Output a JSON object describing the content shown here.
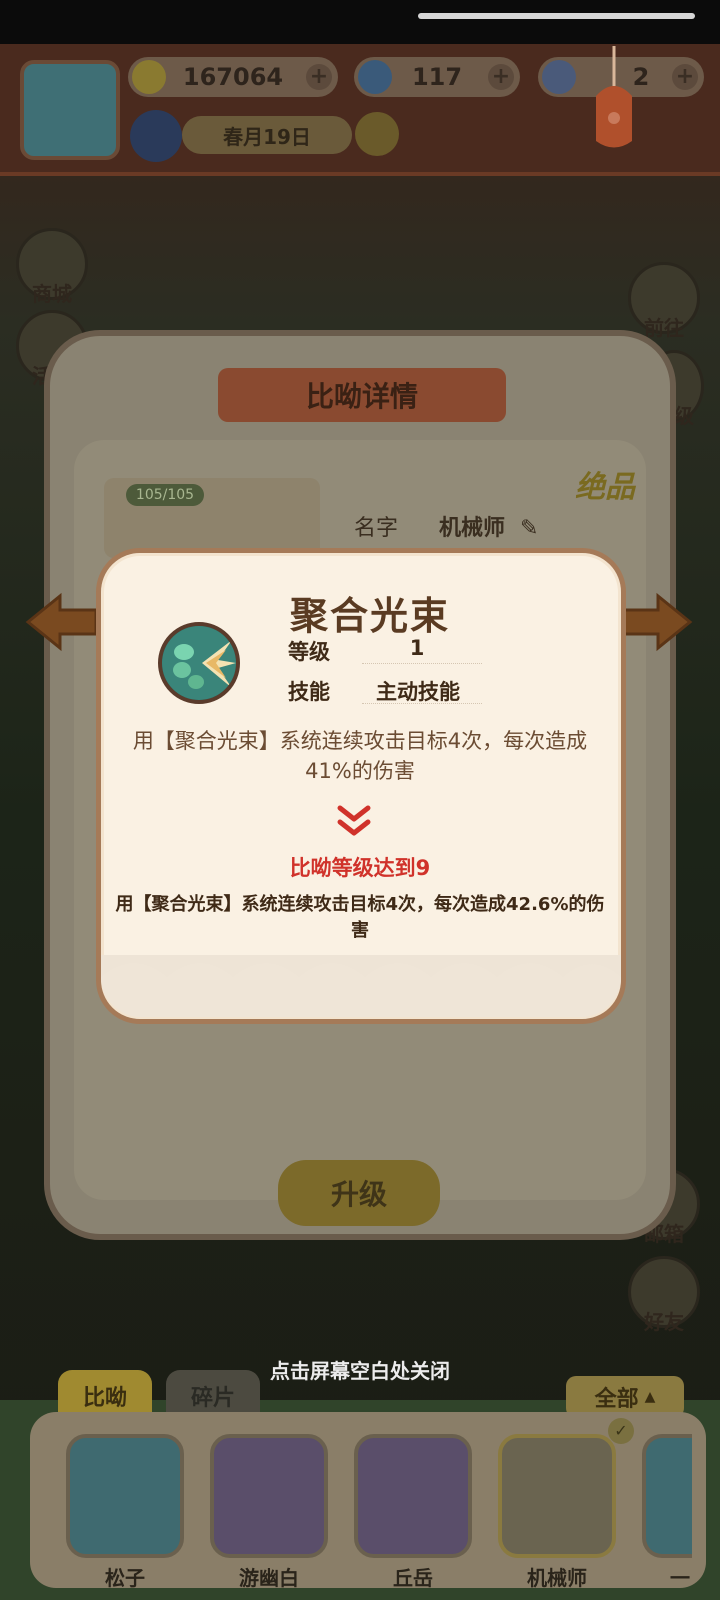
{
  "header": {
    "currency_bananas": "167064",
    "currency_flames": "117",
    "currency_tickets": "2",
    "date_text": "春月19日"
  },
  "side_menu": {
    "left": [
      "商城",
      "活动"
    ],
    "right": [
      "前往",
      "等级",
      "邮箱",
      "好友"
    ]
  },
  "detail_panel": {
    "title": "比呦详情",
    "rarity": "绝品",
    "count": "105/105",
    "name_label": "名字",
    "name_value": "机械师",
    "upgrade_label": "升级"
  },
  "popup": {
    "skill_name": "聚合光束",
    "level_label": "等级",
    "level_value": "1",
    "skill_label": "技能",
    "skill_type": "主动技能",
    "current_description": "用【聚合光束】系统连续攻击目标4次，每次造成41%的伤害",
    "unlock_condition": "比呦等级达到9",
    "next_description": "用【聚合光束】系统连续攻击目标4次，每次造成42.6%的伤害"
  },
  "close_hint": "点击屏幕空白处关闭",
  "bottom": {
    "tabs": [
      "比呦",
      "碎片"
    ],
    "filter_label": "全部",
    "roster": [
      "松子",
      "游幽白",
      "丘岳",
      "机械师",
      "一"
    ]
  },
  "colors": {
    "popup_bg": "#faf1e3",
    "accent_red": "#d0322a",
    "text_brown": "#5a3b22"
  }
}
